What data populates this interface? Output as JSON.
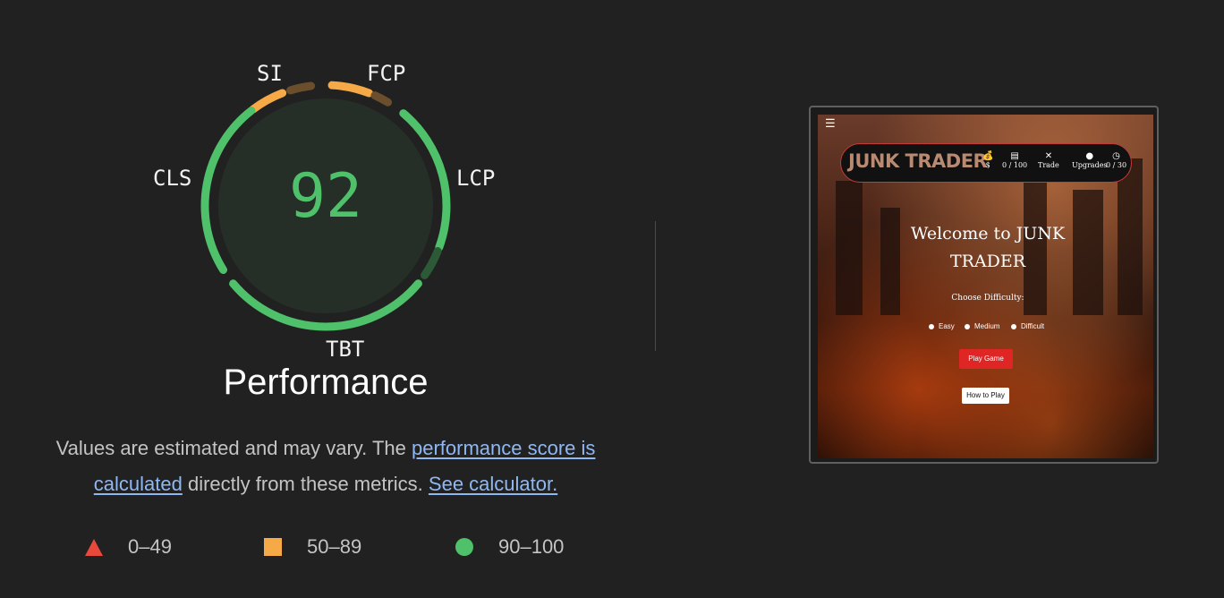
{
  "gauge": {
    "score": "92",
    "category_title": "Performance",
    "metrics": [
      {
        "label": "SI"
      },
      {
        "label": "FCP"
      },
      {
        "label": "LCP"
      },
      {
        "label": "TBT"
      },
      {
        "label": "CLS"
      }
    ],
    "colors": {
      "pass": "#4fc16a",
      "average": "#f5a947",
      "fail": "#e8493b"
    }
  },
  "description": {
    "text_1": "Values are estimated and may vary. The ",
    "link_score": "performance score is calculated",
    "text_2": " directly from these metrics. ",
    "link_calculator": "See calculator."
  },
  "legend": [
    {
      "shape": "triangle",
      "label": "0–49"
    },
    {
      "shape": "square",
      "label": "50–89"
    },
    {
      "shape": "circle",
      "label": "90–100"
    }
  ],
  "screenshot": {
    "menu_icon": "☰",
    "logo": "JUNK TRADER",
    "header_items": [
      {
        "icon": "money-bag-icon",
        "glyph": "💰",
        "label": "$"
      },
      {
        "icon": "briefcase-icon",
        "glyph": "▤",
        "label": "0 / 100"
      },
      {
        "icon": "tools-icon",
        "glyph": "✕",
        "label": "Trade"
      },
      {
        "icon": "upgrade-icon",
        "glyph": "●",
        "label": "Upgrades"
      },
      {
        "icon": "clock-icon",
        "glyph": "◷",
        "label": "0 / 30"
      }
    ],
    "welcome": "Welcome to JUNK TRADER",
    "choose_difficulty": "Choose Difficulty:",
    "difficulties": [
      "Easy",
      "Medium",
      "Difficult"
    ],
    "play_button": "Play Game",
    "how_to_button": "How to Play"
  }
}
